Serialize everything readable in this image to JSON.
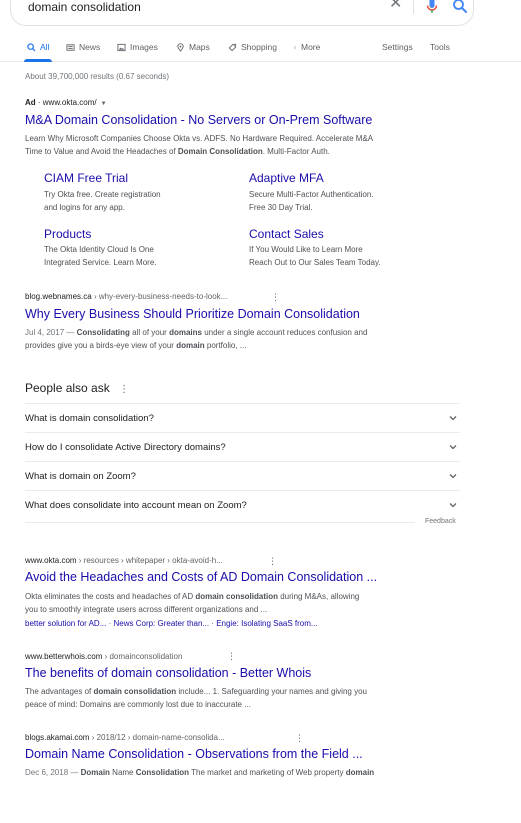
{
  "search": {
    "query": "domain consolidation",
    "clear_icon": "close-icon",
    "mic_icon": "mic-icon",
    "search_icon": "search-icon"
  },
  "tabs": [
    {
      "label": "All",
      "icon": "search-icon",
      "active": true
    },
    {
      "label": "News",
      "icon": "news-icon"
    },
    {
      "label": "Images",
      "icon": "image-icon"
    },
    {
      "label": "Maps",
      "icon": "map-pin-icon"
    },
    {
      "label": "Shopping",
      "icon": "tag-icon"
    },
    {
      "label": "More",
      "icon": "kebab-icon"
    }
  ],
  "tools": {
    "settings": "Settings",
    "tools": "Tools"
  },
  "stats": "About 39,700,000 results (0.67 seconds)",
  "ad": {
    "label": "Ad",
    "url": "www.okta.com/",
    "title": "M&A Domain Consolidation - No Servers or On-Prem Software",
    "desc_1": "Learn Why Microsoft Companies Choose Okta vs. ADFS. No Hardware Required. Accelerate M&A",
    "desc_2a": "Time to Value and Avoid the Headaches of ",
    "desc_2b": "Domain Consolidation",
    "desc_2c": ". Multi-Factor Auth.",
    "sitelinks": [
      {
        "title": "CIAM Free Trial",
        "line1": "Try Okta free. Create registration",
        "line2": "and logins for any app."
      },
      {
        "title": "Adaptive MFA",
        "line1": "Secure Multi-Factor Authentication.",
        "line2": "Free 30 Day Trial."
      },
      {
        "title": "Products",
        "line1": "The Okta Identity Cloud Is One",
        "line2": "Integrated Service. Learn More."
      },
      {
        "title": "Contact Sales",
        "line1": "If You Would Like to Learn More",
        "line2": "Reach Out to Our Sales Team Today."
      }
    ]
  },
  "result1": {
    "site": "blog.webnames.ca",
    "path": " › why-every-business-needs-to-look...",
    "title": "Why Every Business Should Prioritize Domain Consolidation",
    "date": "Jul 4, 2017 — ",
    "s1": "Consolidating",
    "s2": " all of your ",
    "s3": "domains",
    "s4": " under a single account reduces confusion and",
    "s5": "provides give you a birds-eye view of your ",
    "s6": "domain",
    "s7": " portfolio, ..."
  },
  "paa": {
    "title": "People also ask",
    "questions": [
      "What is domain consolidation?",
      "How do I consolidate Active Directory domains?",
      "What is domain on Zoom?",
      "What does consolidate into account mean on Zoom?"
    ],
    "feedback": "Feedback"
  },
  "result2": {
    "site": "www.okta.com",
    "path": " › resources › whitepaper › okta-avoid-h...",
    "title": "Avoid the Headaches and Costs of AD Domain Consolidation ...",
    "l1a": "Okta eliminates the costs and headaches of AD ",
    "l1b": "domain consolidation",
    "l1c": " during M&As, allowing",
    "l2": "you to smoothly integrate users across different organizations and ...",
    "links": [
      "better solution for AD...",
      "News Corp: Greater than...",
      "Engie: Isolating SaaS from..."
    ],
    "link_sep": " · "
  },
  "result3": {
    "site": "www.betterwhois.com",
    "path": " › domainconsolidation",
    "title": "The benefits of domain consolidation - Better Whois",
    "l1a": "The advantages of ",
    "l1b": "domain consolidation",
    "l1c": " include... 1. Safeguarding your names and giving you",
    "l2": "peace of mind: Domains are commonly lost due to inaccurate ..."
  },
  "result4": {
    "site": "blogs.akamai.com",
    "path": " › 2018/12 › domain-name-consolida...",
    "title": "Domain Name Consolidation - Observations from the Field ...",
    "date": "Dec 6, 2018 — ",
    "b1": "Domain",
    "t1": " Name ",
    "b2": "Consolidation",
    "t2": " The market and marketing of Web property ",
    "b3": "domain"
  }
}
